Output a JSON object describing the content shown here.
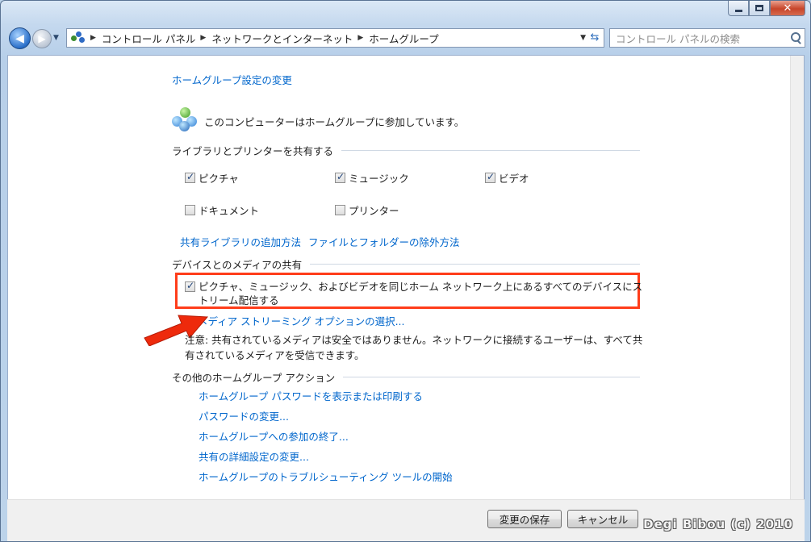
{
  "window": {
    "caption": {
      "minimize": "minimize",
      "maximize": "maximize",
      "close": "✕"
    }
  },
  "address_bar": {
    "crumbs": [
      "コントロール パネル",
      "ネットワークとインターネット",
      "ホームグループ"
    ]
  },
  "search": {
    "placeholder": "コントロール パネルの検索"
  },
  "page": {
    "title_link": "ホームグループ設定の変更",
    "status": "このコンピューターはホームグループに参加しています。",
    "share_section": {
      "heading": "ライブラリとプリンターを共有する",
      "items": [
        {
          "label": "ピクチャ",
          "checked": true
        },
        {
          "label": "ミュージック",
          "checked": true
        },
        {
          "label": "ビデオ",
          "checked": true
        },
        {
          "label": "ドキュメント",
          "checked": false
        },
        {
          "label": "プリンター",
          "checked": false
        }
      ],
      "link_add": "共有ライブラリの追加方法",
      "link_exclude": "ファイルとフォルダーの除外方法"
    },
    "media_section": {
      "heading": "デバイスとのメディアの共有",
      "stream_checkbox_line1": "ピクチャ、ミュージック、およびビデオを同じホーム ネットワーク上にあるすべてのデバイスにス",
      "stream_checkbox_line2": "トリーム配信する",
      "stream_checked": true,
      "options_link": "メディア ストリーミング オプションの選択...",
      "note_line1": "注意: 共有されているメディアは安全ではありません。ネットワークに接続するユーザーは、すべて共",
      "note_line2": "有されているメディアを受信できます。"
    },
    "other_section": {
      "heading": "その他のホームグループ アクション",
      "links": [
        "ホームグループ パスワードを表示または印刷する",
        "パスワードの変更...",
        "ホームグループへの参加の終了...",
        "共有の詳細設定の変更...",
        "ホームグループのトラブルシューティング ツールの開始"
      ]
    }
  },
  "footer": {
    "save_label": "変更の保存",
    "cancel_label": "キャンセル",
    "watermark": "Degi Bibou (c) 2010"
  },
  "colors": {
    "link": "#0066cc",
    "highlight": "#ff3d1a",
    "arrow": "#ee2a0c"
  }
}
